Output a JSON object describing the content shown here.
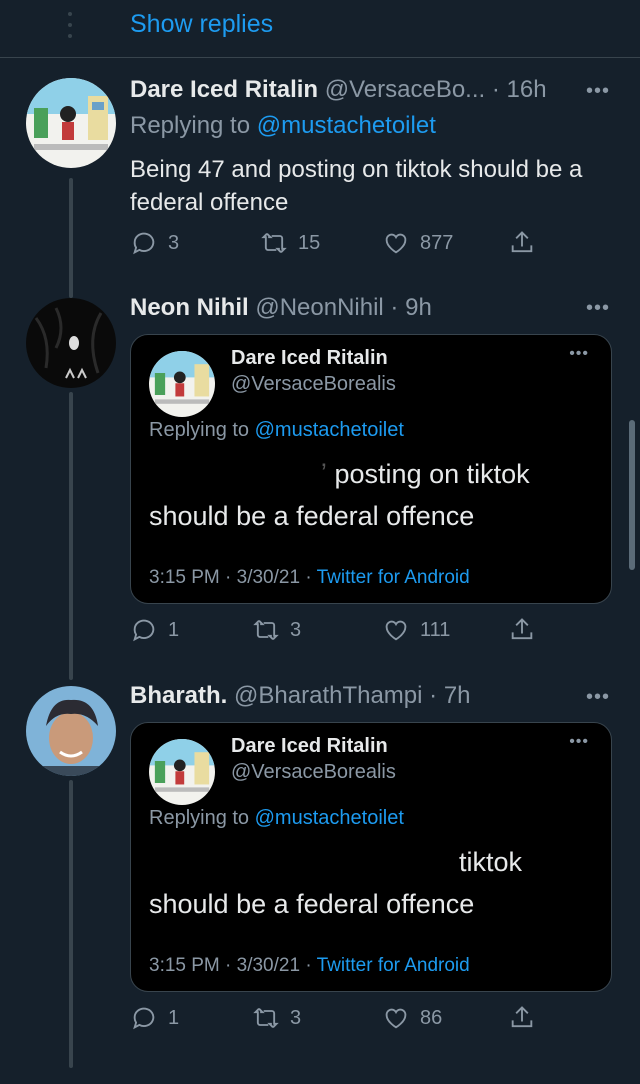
{
  "show_replies": {
    "label": "Show replies"
  },
  "tweets": [
    {
      "name": "Dare Iced Ritalin",
      "handle": "@VersaceBo...",
      "time": "16h",
      "replying_prefix": "Replying to",
      "replying_to": "@mustachetoilet",
      "text": "Being 47 and posting on tiktok should be a federal offence",
      "stats": {
        "replies": "3",
        "retweets": "15",
        "likes": "877"
      }
    },
    {
      "name": "Neon Nihil",
      "handle": "@NeonNihil",
      "time": "9h",
      "quote": {
        "name": "Dare Iced Ritalin",
        "handle": "@VersaceBorealis",
        "replying_prefix": "Replying to",
        "replying_to": "@mustachetoilet",
        "text_line1": "posting on tiktok",
        "text_line2": "should be a federal offence",
        "timestamp": "3:15 PM · 3/30/21 ·",
        "app": "Twitter for Android"
      },
      "stats": {
        "replies": "1",
        "retweets": "3",
        "likes": "111"
      }
    },
    {
      "name": "Bharath.",
      "handle": "@BharathThampi",
      "time": "7h",
      "quote": {
        "name": "Dare Iced Ritalin",
        "handle": "@VersaceBorealis",
        "replying_prefix": "Replying to",
        "replying_to": "@mustachetoilet",
        "text_line1": "tiktok",
        "text_line2": "should be a federal offence",
        "timestamp": "3:15 PM · 3/30/21 ·",
        "app": "Twitter for Android"
      },
      "stats": {
        "replies": "1",
        "retweets": "3",
        "likes": "86"
      }
    }
  ],
  "colors": {
    "background": "#15202b",
    "accent": "#1d9bf0",
    "muted": "#8b98a5",
    "border": "#38444d"
  },
  "icons": [
    "reply-icon",
    "retweet-icon",
    "like-icon",
    "share-icon",
    "more-icon"
  ]
}
